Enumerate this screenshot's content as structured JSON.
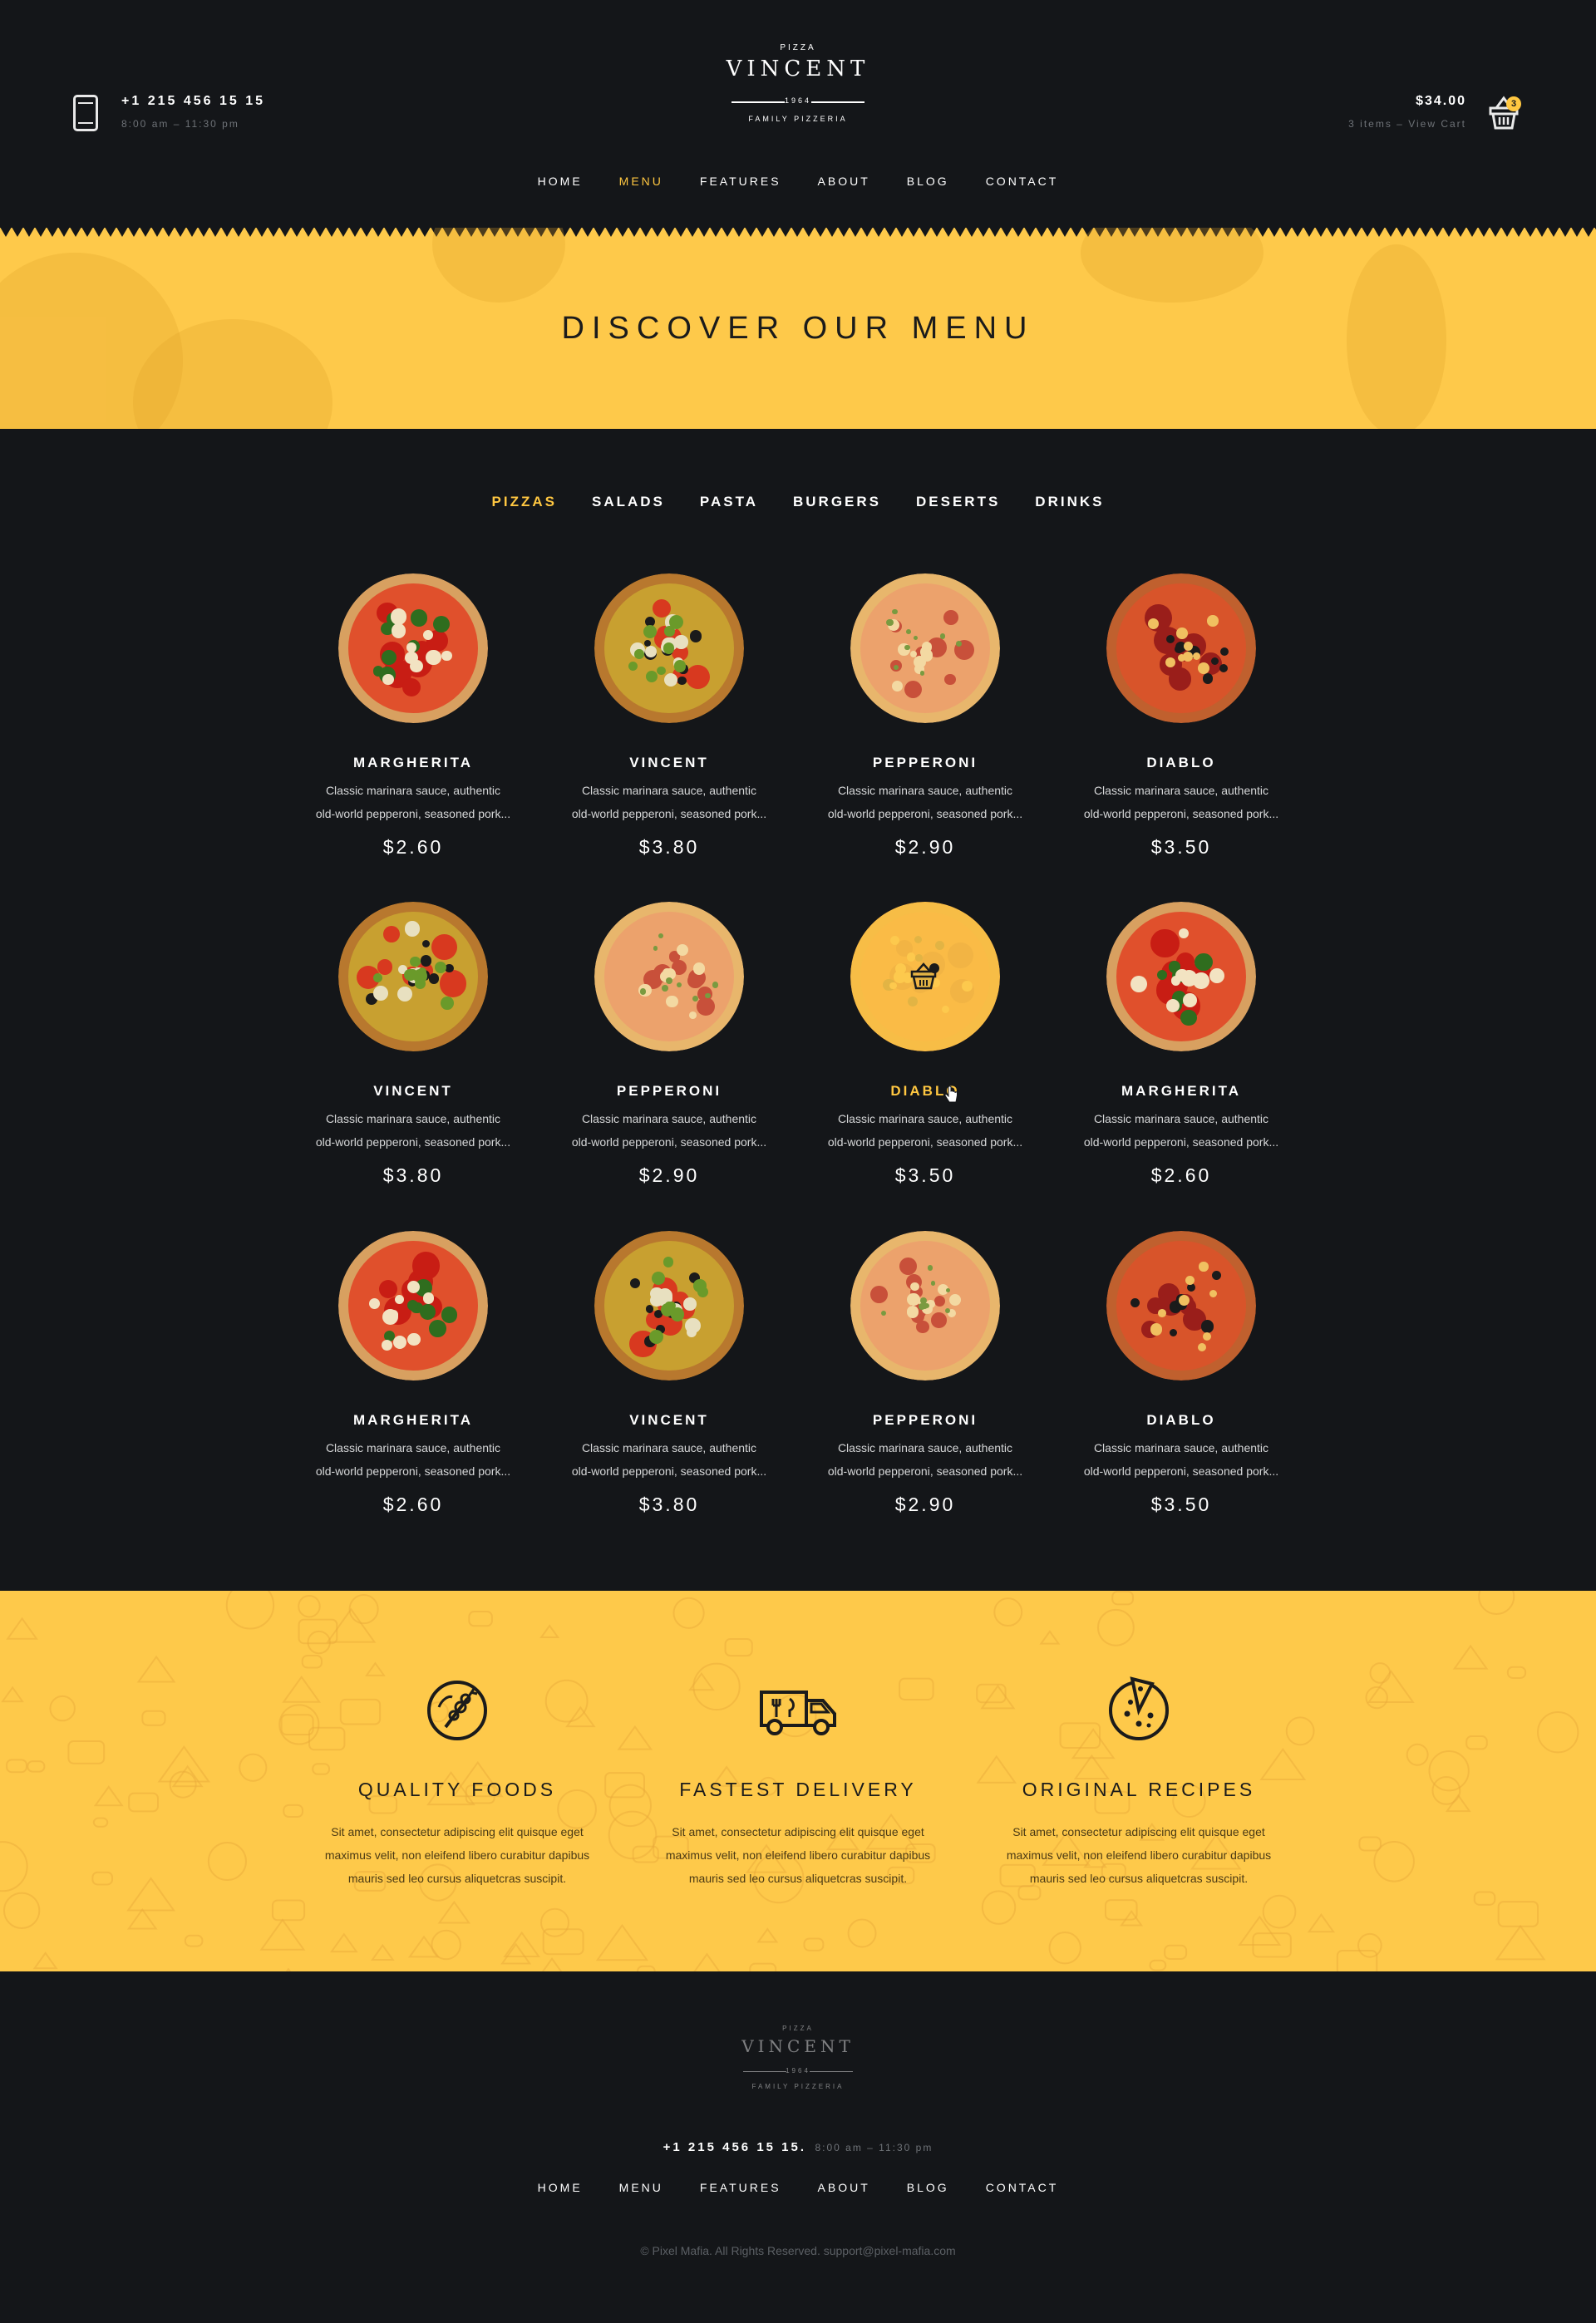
{
  "header": {
    "phone": "+1 215 456 15 15",
    "hours": "8:00 am – 11:30 pm",
    "logo": {
      "top": "PIZZA",
      "name": "VINCENT",
      "year": "1964",
      "sub": "FAMILY PIZZERIA"
    },
    "cart": {
      "total": "$34.00",
      "summary": "3 items – View Cart",
      "badge": "3"
    }
  },
  "nav": [
    {
      "label": "HOME",
      "active": false
    },
    {
      "label": "MENU",
      "active": true
    },
    {
      "label": "FEATURES",
      "active": false
    },
    {
      "label": "ABOUT",
      "active": false
    },
    {
      "label": "BLOG",
      "active": false
    },
    {
      "label": "CONTACT",
      "active": false
    }
  ],
  "hero": {
    "title": "DISCOVER OUR MENU"
  },
  "menu": {
    "tabs": [
      {
        "label": "PIZZAS",
        "active": true
      },
      {
        "label": "SALADS",
        "active": false
      },
      {
        "label": "PASTA",
        "active": false
      },
      {
        "label": "BURGERS",
        "active": false
      },
      {
        "label": "DESERTS",
        "active": false
      },
      {
        "label": "DRINKS",
        "active": false
      }
    ],
    "items": [
      {
        "name": "MARGHERITA",
        "price": "$2.60",
        "desc1": "Classic marinara sauce, authentic",
        "desc2": "old-world pepperoni, seasoned pork..."
      },
      {
        "name": "VINCENT",
        "price": "$3.80",
        "desc1": "Classic marinara sauce, authentic",
        "desc2": "old-world pepperoni, seasoned pork..."
      },
      {
        "name": "PEPPERONI",
        "price": "$2.90",
        "desc1": "Classic marinara sauce, authentic",
        "desc2": "old-world pepperoni, seasoned pork..."
      },
      {
        "name": "DIABLO",
        "price": "$3.50",
        "desc1": "Classic marinara sauce, authentic",
        "desc2": "old-world pepperoni, seasoned pork..."
      },
      {
        "name": "VINCENT",
        "price": "$3.80",
        "desc1": "Classic marinara sauce, authentic",
        "desc2": "old-world pepperoni, seasoned pork..."
      },
      {
        "name": "PEPPERONI",
        "price": "$2.90",
        "desc1": "Classic marinara sauce, authentic",
        "desc2": "old-world pepperoni, seasoned pork..."
      },
      {
        "name": "DIABLO",
        "price": "$3.50",
        "desc1": "Classic marinara sauce, authentic",
        "desc2": "old-world pepperoni, seasoned pork..."
      },
      {
        "name": "MARGHERITA",
        "price": "$2.60",
        "desc1": "Classic marinara sauce, authentic",
        "desc2": "old-world pepperoni, seasoned pork..."
      },
      {
        "name": "MARGHERITA",
        "price": "$2.60",
        "desc1": "Classic marinara sauce, authentic",
        "desc2": "old-world pepperoni, seasoned pork..."
      },
      {
        "name": "VINCENT",
        "price": "$3.80",
        "desc1": "Classic marinara sauce, authentic",
        "desc2": "old-world pepperoni, seasoned pork..."
      },
      {
        "name": "PEPPERONI",
        "price": "$2.90",
        "desc1": "Classic marinara sauce, authentic",
        "desc2": "old-world pepperoni, seasoned pork..."
      },
      {
        "name": "DIABLO",
        "price": "$3.50",
        "desc1": "Classic marinara sauce, authentic",
        "desc2": "old-world pepperoni, seasoned pork..."
      }
    ]
  },
  "features": [
    {
      "title": "QUALITY FOODS",
      "icon": "quality-food-icon",
      "desc1": "Sit amet, consectetur adipiscing elit quisque eget",
      "desc2": "maximus velit, non eleifend libero curabitur dapibus",
      "desc3": "mauris sed leo cursus aliquetcras suscipit."
    },
    {
      "title": "FASTEST DELIVERY",
      "icon": "delivery-truck-icon",
      "desc1": "Sit amet, consectetur adipiscing elit quisque eget",
      "desc2": "maximus velit, non eleifend libero curabitur dapibus",
      "desc3": "mauris sed leo cursus aliquetcras suscipit."
    },
    {
      "title": "ORIGINAL RECIPES",
      "icon": "pizza-icon",
      "desc1": "Sit amet, consectetur adipiscing elit quisque eget",
      "desc2": "maximus velit, non eleifend libero curabitur dapibus",
      "desc3": "mauris sed leo cursus aliquetcras suscipit."
    }
  ],
  "footer": {
    "phone": "+1 215 456 15 15.",
    "hours": "8:00 am – 11:30 pm",
    "nav": [
      "HOME",
      "MENU",
      "FEATURES",
      "ABOUT",
      "BLOG",
      "CONTACT"
    ],
    "copyright": "© Pixel Mafia. All Rights Reserved. support@pixel-mafia.com"
  },
  "colors": {
    "accent": "#ffc741",
    "background": "#141619",
    "band": "#fec94a"
  }
}
